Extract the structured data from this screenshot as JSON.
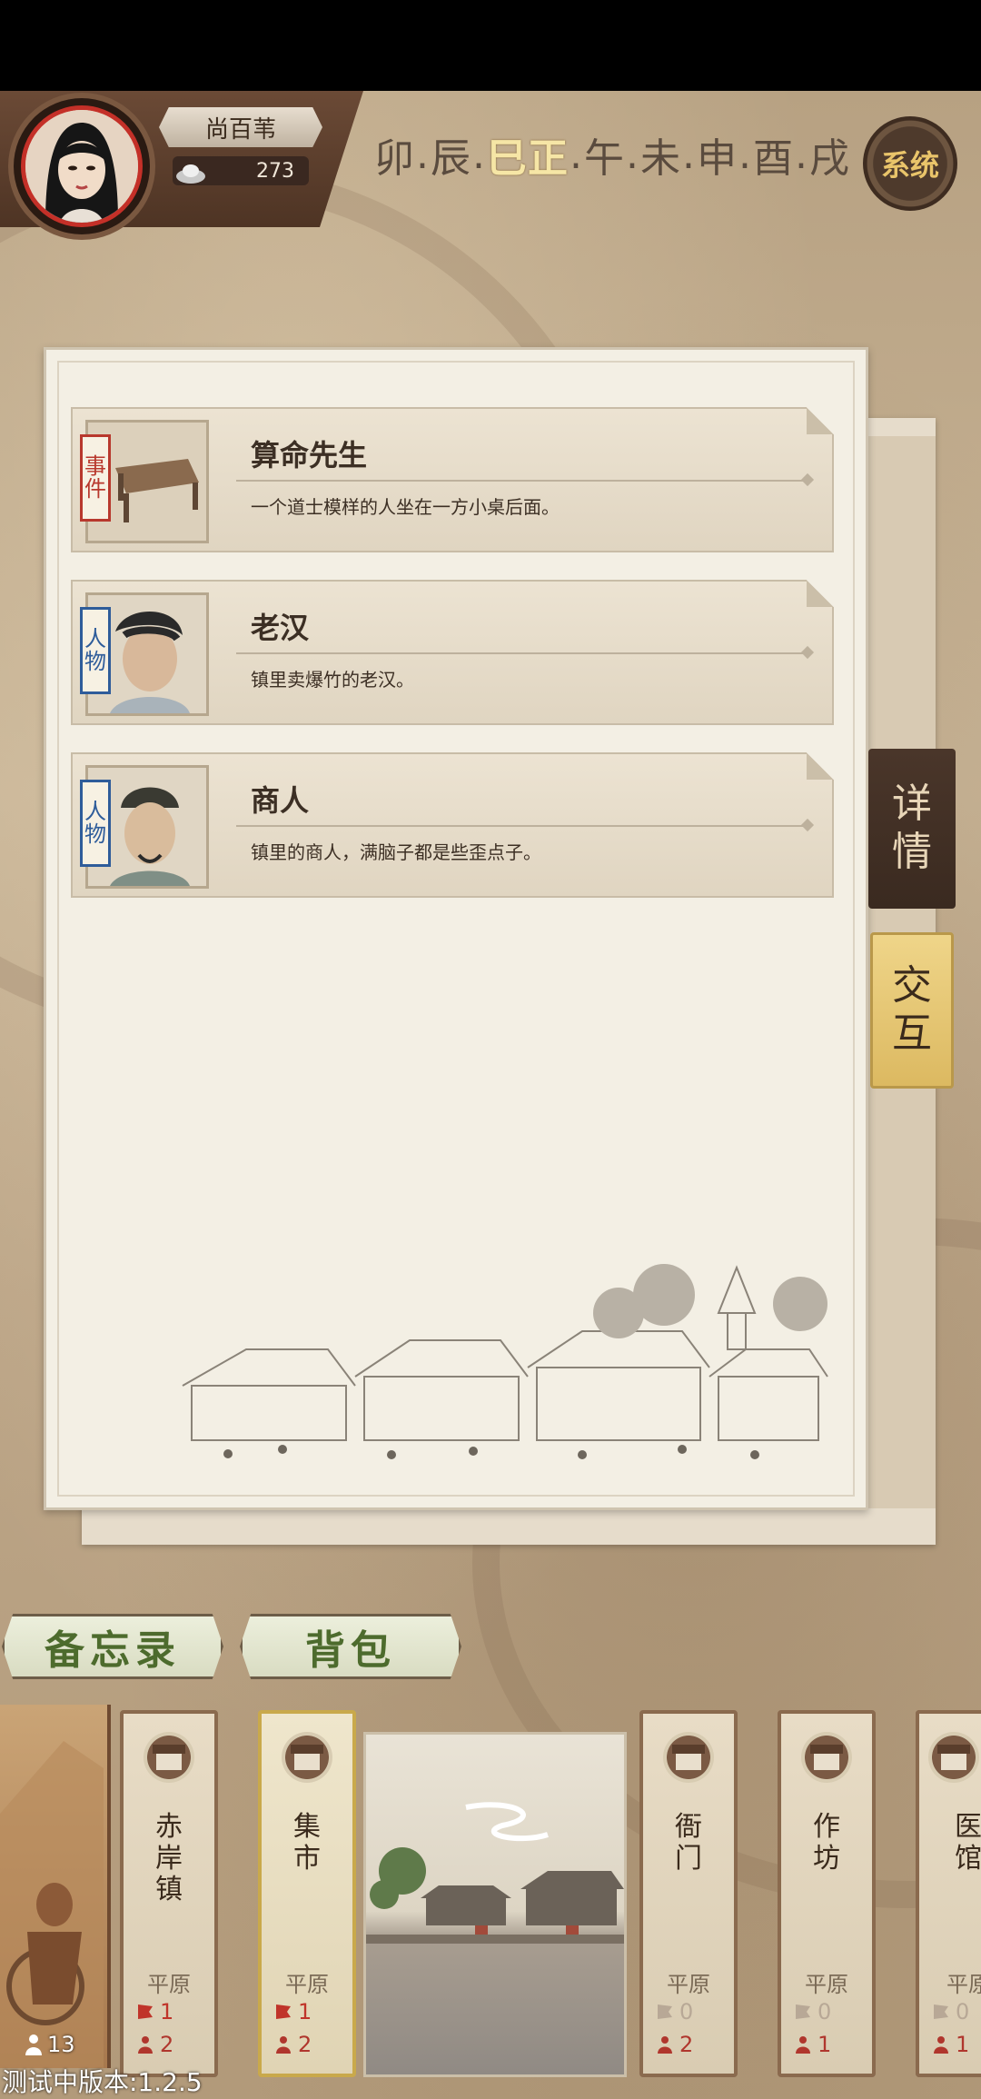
{
  "header": {
    "player_name": "尚百苇",
    "silver": "273",
    "time_slots": [
      "卯",
      "辰",
      "巳正",
      "午",
      "未",
      "申",
      "酉",
      "戌"
    ],
    "time_separator": ".",
    "active_slot": "巳正",
    "system_button": "系统"
  },
  "entries": [
    {
      "tag": [
        "事",
        "件"
      ],
      "tag_color": "#b8382d",
      "title": "算命先生",
      "desc": "一个道士模样的人坐在一方小桌后面。"
    },
    {
      "tag": [
        "人",
        "物"
      ],
      "tag_color": "#2e5c9a",
      "title": "老汉",
      "desc": "镇里卖爆竹的老汉。"
    },
    {
      "tag": [
        "人",
        "物"
      ],
      "tag_color": "#2e5c9a",
      "title": "商人",
      "desc": "镇里的商人，满脑子都是些歪点子。"
    }
  ],
  "side_tabs": {
    "detail": [
      "详",
      "情"
    ],
    "interact": [
      "交",
      "互"
    ]
  },
  "bottom_buttons": {
    "memo": "备忘录",
    "bag": "背包"
  },
  "locations": [
    {
      "name": [
        "赤",
        "岸",
        "镇"
      ],
      "terrain": "平原",
      "events": "1",
      "people": "2",
      "selected": false
    },
    {
      "name": [
        "集",
        "市"
      ],
      "terrain": "平原",
      "events": "1",
      "people": "2",
      "selected": true
    },
    {
      "name": [
        "衙",
        "门"
      ],
      "terrain": "平原",
      "events": "0",
      "people": "2",
      "selected": false
    },
    {
      "name": [
        "作",
        "坊"
      ],
      "terrain": "平原",
      "events": "0",
      "people": "1",
      "selected": false
    },
    {
      "name": [
        "医",
        "馆"
      ],
      "terrain": "平原",
      "events": "0",
      "people": "1",
      "selected": false
    }
  ],
  "party_count": "13",
  "version": "测试中版本:1.2.5"
}
